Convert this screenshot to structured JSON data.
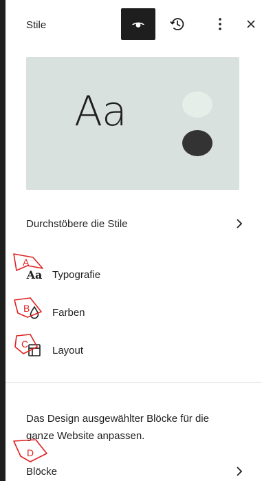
{
  "header": {
    "title": "Stile"
  },
  "preview": {
    "sample_text": "Aa"
  },
  "browse": {
    "label": "Durchstöbere die Stile"
  },
  "nav": {
    "typography": {
      "icon_text": "Aa",
      "label": "Typografie"
    },
    "colors": {
      "label": "Farben"
    },
    "layout": {
      "label": "Layout"
    }
  },
  "blocks": {
    "description": "Das Design ausgewählter Blöcke für die ganze Website anpassen.",
    "label": "Blöcke"
  },
  "annotations": [
    {
      "letter": "A"
    },
    {
      "letter": "B"
    },
    {
      "letter": "C"
    },
    {
      "letter": "D"
    }
  ],
  "colors": {
    "accent_dark": "#1e1e1e",
    "preview_bg": "#d8e1dd",
    "annotation_red": "#e02020"
  },
  "icons": {
    "eye": "eye-icon",
    "revisions": "history-icon",
    "more": "more-vertical-icon",
    "close": "close-icon",
    "chevron": "chevron-right-icon",
    "drop": "droplet-icon",
    "layout": "layout-icon"
  }
}
